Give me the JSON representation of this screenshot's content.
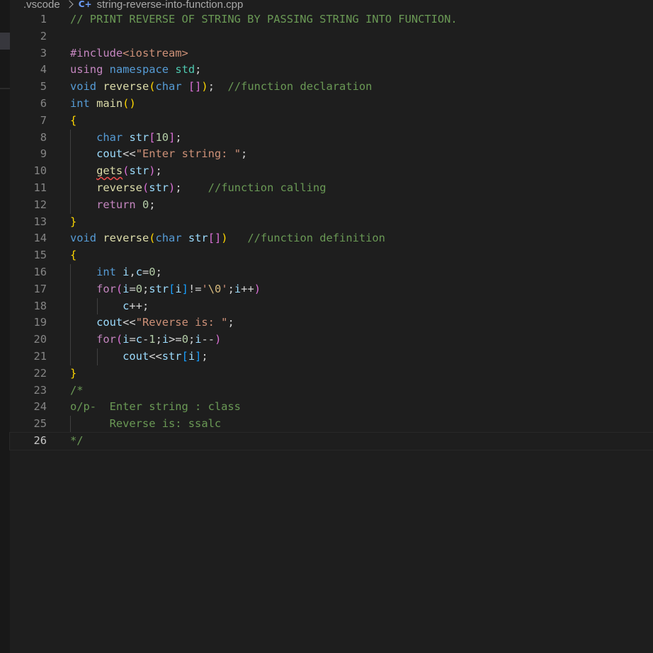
{
  "breadcrumb": {
    "folder": ".vscode",
    "file_icon": "cpp-file-icon",
    "file": "string-reverse-into-function.cpp"
  },
  "colors": {
    "background": "#1e1e1e",
    "comment": "#6a9955",
    "keyword": "#569cd6",
    "control": "#c586c0",
    "function": "#dcdcaa",
    "variable": "#9cdcfe",
    "string": "#ce9178",
    "number": "#b5cea8"
  },
  "editor": {
    "current_line": 26,
    "lines": [
      {
        "n": "1",
        "t": [
          [
            "// PRINT REVERSE OF STRING BY PASSING STRING INTO FUNCTION.",
            "cmt"
          ]
        ]
      },
      {
        "n": "2",
        "t": []
      },
      {
        "n": "3",
        "t": [
          [
            "#include",
            "ctrl"
          ],
          [
            "<iostream>",
            "str"
          ]
        ]
      },
      {
        "n": "4",
        "t": [
          [
            "using",
            "ctrl"
          ],
          [
            " ",
            "txt"
          ],
          [
            "namespace",
            "kw"
          ],
          [
            " ",
            "txt"
          ],
          [
            "std",
            "ns"
          ],
          [
            ";",
            "txt"
          ]
        ]
      },
      {
        "n": "5",
        "t": [
          [
            "void",
            "kw"
          ],
          [
            " ",
            "txt"
          ],
          [
            "reverse",
            "fn"
          ],
          [
            "(",
            "b1"
          ],
          [
            "char",
            "kw"
          ],
          [
            " ",
            "txt"
          ],
          [
            "[]",
            "b2"
          ],
          [
            ")",
            "b1"
          ],
          [
            ";  ",
            "txt"
          ],
          [
            "//function declaration",
            "cmt"
          ]
        ]
      },
      {
        "n": "6",
        "t": [
          [
            "int",
            "kw"
          ],
          [
            " ",
            "txt"
          ],
          [
            "main",
            "fn"
          ],
          [
            "()",
            "b1"
          ]
        ]
      },
      {
        "n": "7",
        "t": [
          [
            "{",
            "b1"
          ]
        ]
      },
      {
        "n": "8",
        "g": [
          1
        ],
        "t": [
          [
            "    ",
            "txt"
          ],
          [
            "char",
            "kw"
          ],
          [
            " ",
            "txt"
          ],
          [
            "str",
            "var"
          ],
          [
            "[",
            "b2"
          ],
          [
            "10",
            "num"
          ],
          [
            "]",
            "b2"
          ],
          [
            ";",
            "txt"
          ]
        ]
      },
      {
        "n": "9",
        "g": [
          1
        ],
        "t": [
          [
            "    ",
            "txt"
          ],
          [
            "cout",
            "var"
          ],
          [
            "<<",
            "txt"
          ],
          [
            "\"Enter string: \"",
            "str"
          ],
          [
            ";",
            "txt"
          ]
        ]
      },
      {
        "n": "10",
        "g": [
          1
        ],
        "t": [
          [
            "    ",
            "txt"
          ],
          [
            "gets",
            "fn err"
          ],
          [
            "(",
            "b2"
          ],
          [
            "str",
            "var"
          ],
          [
            ")",
            "b2"
          ],
          [
            ";",
            "txt"
          ]
        ]
      },
      {
        "n": "11",
        "g": [
          1
        ],
        "t": [
          [
            "    ",
            "txt"
          ],
          [
            "reverse",
            "fn"
          ],
          [
            "(",
            "b2"
          ],
          [
            "str",
            "var"
          ],
          [
            ")",
            "b2"
          ],
          [
            ";    ",
            "txt"
          ],
          [
            "//function calling",
            "cmt"
          ]
        ]
      },
      {
        "n": "12",
        "g": [
          1
        ],
        "t": [
          [
            "    ",
            "txt"
          ],
          [
            "return",
            "ctrl"
          ],
          [
            " ",
            "txt"
          ],
          [
            "0",
            "num"
          ],
          [
            ";",
            "txt"
          ]
        ]
      },
      {
        "n": "13",
        "t": [
          [
            "}",
            "b1"
          ]
        ]
      },
      {
        "n": "14",
        "t": [
          [
            "void",
            "kw"
          ],
          [
            " ",
            "txt"
          ],
          [
            "reverse",
            "fn"
          ],
          [
            "(",
            "b1"
          ],
          [
            "char",
            "kw"
          ],
          [
            " ",
            "txt"
          ],
          [
            "str",
            "var"
          ],
          [
            "[]",
            "b2"
          ],
          [
            ")",
            "b1"
          ],
          [
            "   ",
            "txt"
          ],
          [
            "//function definition",
            "cmt"
          ]
        ]
      },
      {
        "n": "15",
        "t": [
          [
            "{",
            "b1"
          ]
        ]
      },
      {
        "n": "16",
        "g": [
          1
        ],
        "t": [
          [
            "    ",
            "txt"
          ],
          [
            "int",
            "kw"
          ],
          [
            " ",
            "txt"
          ],
          [
            "i",
            "var"
          ],
          [
            ",",
            "txt"
          ],
          [
            "c",
            "var"
          ],
          [
            "=",
            "txt"
          ],
          [
            "0",
            "num"
          ],
          [
            ";",
            "txt"
          ]
        ]
      },
      {
        "n": "17",
        "g": [
          1
        ],
        "t": [
          [
            "    ",
            "txt"
          ],
          [
            "for",
            "ctrl"
          ],
          [
            "(",
            "b2"
          ],
          [
            "i",
            "var"
          ],
          [
            "=",
            "txt"
          ],
          [
            "0",
            "num"
          ],
          [
            ";",
            "txt"
          ],
          [
            "str",
            "var"
          ],
          [
            "[",
            "b3"
          ],
          [
            "i",
            "var"
          ],
          [
            "]",
            "b3"
          ],
          [
            "!=",
            "txt"
          ],
          [
            "'",
            "str"
          ],
          [
            "\\0",
            "esc"
          ],
          [
            "'",
            "str"
          ],
          [
            ";",
            "txt"
          ],
          [
            "i",
            "var"
          ],
          [
            "++",
            "txt"
          ],
          [
            ")",
            "b2"
          ]
        ]
      },
      {
        "n": "18",
        "g": [
          1,
          2
        ],
        "t": [
          [
            "        ",
            "txt"
          ],
          [
            "c",
            "var"
          ],
          [
            "++;",
            "txt"
          ]
        ]
      },
      {
        "n": "19",
        "g": [
          1
        ],
        "t": [
          [
            "    ",
            "txt"
          ],
          [
            "cout",
            "var"
          ],
          [
            "<<",
            "txt"
          ],
          [
            "\"Reverse is: \"",
            "str"
          ],
          [
            ";",
            "txt"
          ]
        ]
      },
      {
        "n": "20",
        "g": [
          1
        ],
        "t": [
          [
            "    ",
            "txt"
          ],
          [
            "for",
            "ctrl"
          ],
          [
            "(",
            "b2"
          ],
          [
            "i",
            "var"
          ],
          [
            "=",
            "txt"
          ],
          [
            "c",
            "var"
          ],
          [
            "-",
            "txt"
          ],
          [
            "1",
            "num"
          ],
          [
            ";",
            "txt"
          ],
          [
            "i",
            "var"
          ],
          [
            ">=",
            "txt"
          ],
          [
            "0",
            "num"
          ],
          [
            ";",
            "txt"
          ],
          [
            "i",
            "var"
          ],
          [
            "--",
            "txt"
          ],
          [
            ")",
            "b2"
          ]
        ]
      },
      {
        "n": "21",
        "g": [
          1,
          2
        ],
        "t": [
          [
            "        ",
            "txt"
          ],
          [
            "cout",
            "var"
          ],
          [
            "<<",
            "txt"
          ],
          [
            "str",
            "var"
          ],
          [
            "[",
            "b3"
          ],
          [
            "i",
            "var"
          ],
          [
            "]",
            "b3"
          ],
          [
            ";",
            "txt"
          ]
        ]
      },
      {
        "n": "22",
        "t": [
          [
            "}",
            "b1"
          ]
        ]
      },
      {
        "n": "23",
        "t": [
          [
            "/*",
            "cmt"
          ]
        ]
      },
      {
        "n": "24",
        "t": [
          [
            "o/p-  Enter string : class",
            "cmt"
          ]
        ]
      },
      {
        "n": "25",
        "g": [
          1
        ],
        "t": [
          [
            "      Reverse is: ssalc",
            "cmt"
          ]
        ]
      },
      {
        "n": "26",
        "t": [
          [
            "*/",
            "cmt"
          ]
        ]
      }
    ]
  }
}
